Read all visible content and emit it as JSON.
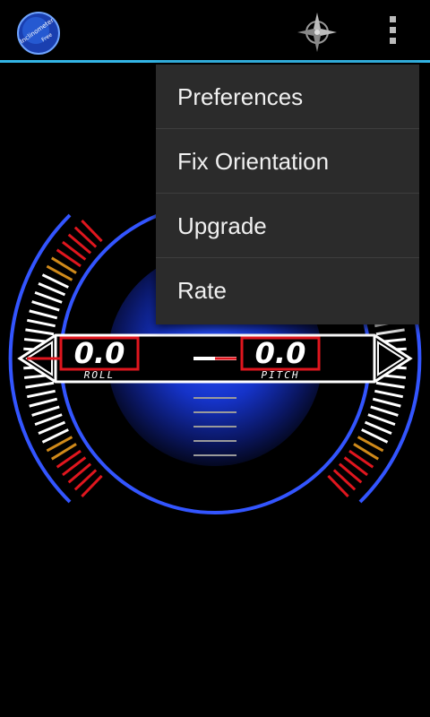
{
  "app": {
    "logo_text_line1": "Inclinometer",
    "logo_text_line2": "Free",
    "logo_icon": "app-logo-icon",
    "compass_icon": "compass-icon",
    "overflow_icon": "overflow-menu-icon",
    "accent_color": "#33b5e5"
  },
  "gauge": {
    "roll_value": "0.0",
    "roll_label": "ROLL",
    "pitch_value": "0.0",
    "pitch_label": "PITCH",
    "roll_deg": 0,
    "pitch_deg": 0,
    "ring_color": "#3355ff",
    "readout_border_color": "#e0161e"
  },
  "menu": {
    "items": [
      {
        "label": "Preferences"
      },
      {
        "label": "Fix Orientation"
      },
      {
        "label": "Upgrade"
      },
      {
        "label": "Rate"
      }
    ]
  }
}
